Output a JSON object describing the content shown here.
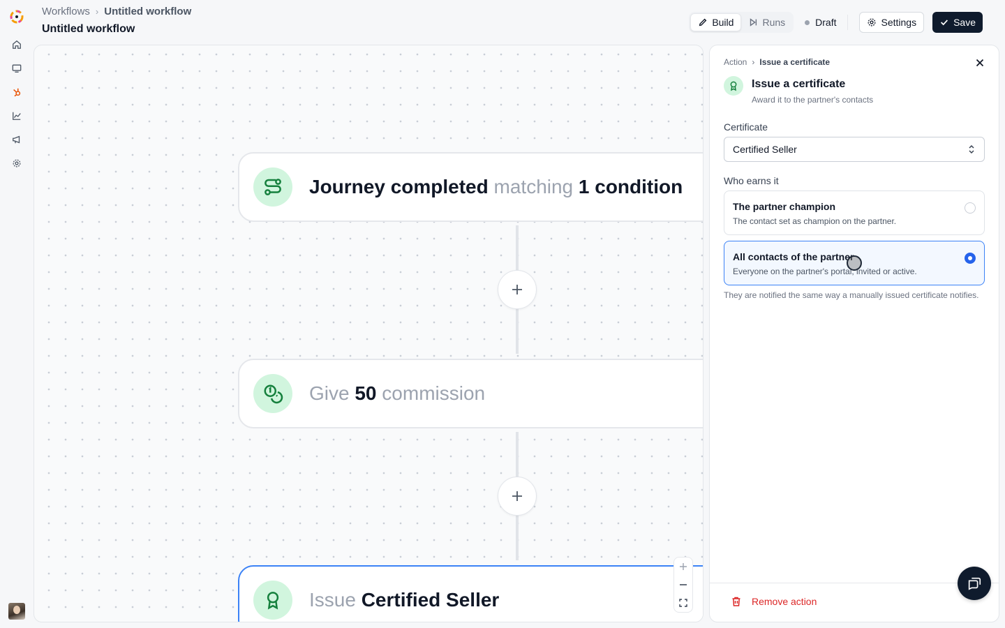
{
  "header": {
    "breadcrumb": [
      "Workflows",
      "Untitled workflow"
    ],
    "title": "Untitled workflow"
  },
  "toolbar": {
    "tabs": [
      {
        "label": "Build",
        "icon": "pencil-icon",
        "active": true
      },
      {
        "label": "Runs",
        "icon": "play-icon",
        "active": false
      }
    ],
    "status": "Draft",
    "settings_label": "Settings",
    "save_label": "Save"
  },
  "sidebar": {
    "items": [
      {
        "name": "home",
        "icon": "home-icon"
      },
      {
        "name": "portal",
        "icon": "monitor-icon"
      },
      {
        "name": "hubspot",
        "icon": "hubspot-icon"
      },
      {
        "name": "analytics",
        "icon": "chart-icon"
      },
      {
        "name": "campaigns",
        "icon": "megaphone-icon"
      },
      {
        "name": "settings",
        "icon": "gear-icon"
      }
    ]
  },
  "workflow": {
    "nodes": [
      {
        "icon": "route-icon",
        "parts": [
          {
            "text": "Journey completed",
            "style": "strong"
          },
          {
            "text": " matching ",
            "style": "muted"
          },
          {
            "text": "1 condition",
            "style": "strong"
          }
        ]
      },
      {
        "icon": "coins-icon",
        "parts": [
          {
            "text": "Give ",
            "style": "muted"
          },
          {
            "text": "50",
            "style": "strong"
          },
          {
            "text": " commission",
            "style": "muted"
          }
        ]
      },
      {
        "icon": "award-icon",
        "parts": [
          {
            "text": "Issue ",
            "style": "muted"
          },
          {
            "text": "Certified Seller",
            "style": "strong"
          }
        ]
      }
    ]
  },
  "panel": {
    "breadcrumb": [
      "Action",
      "Issue a certificate"
    ],
    "title": "Issue a certificate",
    "subtitle": "Award it to the partner's contacts",
    "certificate_label": "Certificate",
    "certificate_value": "Certified Seller",
    "who_label": "Who earns it",
    "options": [
      {
        "title": "The partner champion",
        "desc": "The contact set as champion on the partner.",
        "selected": false
      },
      {
        "title": "All contacts of the partner",
        "desc": "Everyone on the partner's portal, invited or active.",
        "selected": true
      }
    ],
    "note": "They are notified the same way a manually issued certificate notifies.",
    "remove_label": "Remove action"
  },
  "colors": {
    "accent": "#2563eb",
    "primary_dark": "#0f1b2d",
    "node_icon_bg": "#d1f5de",
    "node_icon_fg": "#15803d",
    "danger": "#dc2626"
  }
}
